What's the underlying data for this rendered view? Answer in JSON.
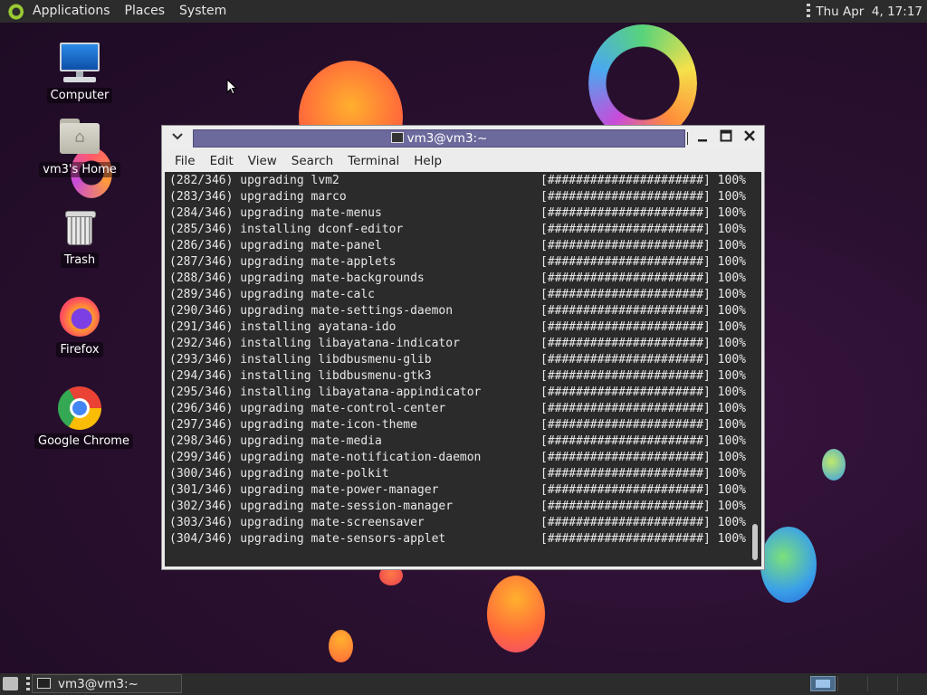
{
  "top_panel": {
    "menus": [
      "Applications",
      "Places",
      "System"
    ],
    "clock": "Thu Apr  4, 17:17"
  },
  "desktop_icons": [
    {
      "label": "Computer",
      "icon": "computer-icon"
    },
    {
      "label": "vm3's Home",
      "icon": "home-folder-icon"
    },
    {
      "label": "Trash",
      "icon": "trash-icon"
    },
    {
      "label": "Firefox",
      "icon": "firefox-icon"
    },
    {
      "label": "Google Chrome",
      "icon": "chrome-icon"
    }
  ],
  "terminal": {
    "title": "vm3@vm3:~",
    "menus": [
      "File",
      "Edit",
      "View",
      "Search",
      "Terminal",
      "Help"
    ],
    "lines": [
      {
        "text": "(282/346) upgrading lvm2",
        "progress": "[######################] 100%"
      },
      {
        "text": "(283/346) upgrading marco",
        "progress": "[######################] 100%"
      },
      {
        "text": "(284/346) upgrading mate-menus",
        "progress": "[######################] 100%"
      },
      {
        "text": "(285/346) installing dconf-editor",
        "progress": "[######################] 100%"
      },
      {
        "text": "(286/346) upgrading mate-panel",
        "progress": "[######################] 100%"
      },
      {
        "text": "(287/346) upgrading mate-applets",
        "progress": "[######################] 100%"
      },
      {
        "text": "(288/346) upgrading mate-backgrounds",
        "progress": "[######################] 100%"
      },
      {
        "text": "(289/346) upgrading mate-calc",
        "progress": "[######################] 100%"
      },
      {
        "text": "(290/346) upgrading mate-settings-daemon",
        "progress": "[######################] 100%"
      },
      {
        "text": "(291/346) installing ayatana-ido",
        "progress": "[######################] 100%"
      },
      {
        "text": "(292/346) installing libayatana-indicator",
        "progress": "[######################] 100%"
      },
      {
        "text": "(293/346) installing libdbusmenu-glib",
        "progress": "[######################] 100%"
      },
      {
        "text": "(294/346) installing libdbusmenu-gtk3",
        "progress": "[######################] 100%"
      },
      {
        "text": "(295/346) installing libayatana-appindicator",
        "progress": "[######################] 100%"
      },
      {
        "text": "(296/346) upgrading mate-control-center",
        "progress": "[######################] 100%"
      },
      {
        "text": "(297/346) upgrading mate-icon-theme",
        "progress": "[######################] 100%"
      },
      {
        "text": "(298/346) upgrading mate-media",
        "progress": "[######################] 100%"
      },
      {
        "text": "(299/346) upgrading mate-notification-daemon",
        "progress": "[######################] 100%"
      },
      {
        "text": "(300/346) upgrading mate-polkit",
        "progress": "[######################] 100%"
      },
      {
        "text": "(301/346) upgrading mate-power-manager",
        "progress": "[######################] 100%"
      },
      {
        "text": "(302/346) upgrading mate-session-manager",
        "progress": "[######################] 100%"
      },
      {
        "text": "(303/346) upgrading mate-screensaver",
        "progress": "[######################] 100%"
      },
      {
        "text": "(304/346) upgrading mate-sensors-applet",
        "progress": "[######################] 100%"
      }
    ]
  },
  "taskbar": {
    "window_button": "vm3@vm3:~"
  }
}
